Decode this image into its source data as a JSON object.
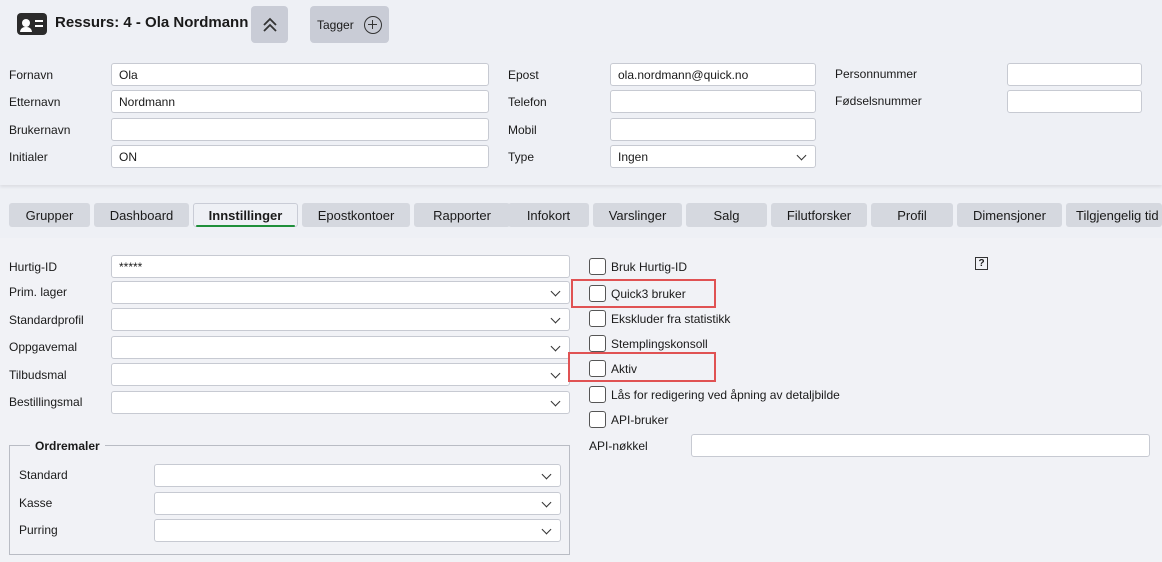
{
  "header": {
    "title": "Ressurs: 4 - Ola Nordmann",
    "tags_label": "Tagger"
  },
  "person": {
    "fornavn_label": "Fornavn",
    "fornavn": "Ola",
    "etternavn_label": "Etternavn",
    "etternavn": "Nordmann",
    "brukernavn_label": "Brukernavn",
    "brukernavn": "",
    "initialer_label": "Initialer",
    "initialer": "ON",
    "epost_label": "Epost",
    "epost": "ola.nordmann@quick.no",
    "telefon_label": "Telefon",
    "telefon": "",
    "mobil_label": "Mobil",
    "mobil": "",
    "type_label": "Type",
    "type": "Ingen",
    "personnummer_label": "Personnummer",
    "personnummer": "",
    "fodselsnummer_label": "Fødselsnummer",
    "fodselsnummer": ""
  },
  "tabs": [
    "Grupper",
    "Dashboard",
    "Innstillinger",
    "Epostkontoer",
    "Rapporter",
    "Infokort",
    "Varslinger",
    "Salg",
    "Filutforsker",
    "Profil",
    "Dimensjoner",
    "Tilgjengelig tid"
  ],
  "active_tab": "Innstillinger",
  "settings": {
    "hurtig_id_label": "Hurtig-ID",
    "hurtig_id": "*****",
    "prim_lager_label": "Prim. lager",
    "prim_lager": "",
    "standardprofil_label": "Standardprofil",
    "standardprofil": "",
    "oppgavemal_label": "Oppgavemal",
    "oppgavemal": "",
    "tilbudsmal_label": "Tilbudsmal",
    "tilbudsmal": "",
    "bestillingsmal_label": "Bestillingsmal",
    "bestillingsmal": "",
    "checkboxes": [
      {
        "label": "Bruk Hurtig-ID",
        "checked": false
      },
      {
        "label": "Quick3 bruker",
        "checked": false
      },
      {
        "label": "Ekskluder fra statistikk",
        "checked": false
      },
      {
        "label": "Stemplingskonsoll",
        "checked": false
      },
      {
        "label": "Aktiv",
        "checked": false
      },
      {
        "label": "Lås for redigering ved åpning av detaljbilde",
        "checked": false
      },
      {
        "label": "API-bruker",
        "checked": false
      }
    ],
    "api_key_label": "API-nøkkel",
    "api_key": "",
    "help_glyph": "?"
  },
  "ordremaler": {
    "legend": "Ordremaler",
    "standard_label": "Standard",
    "standard": "",
    "kasse_label": "Kasse",
    "kasse": "",
    "purring_label": "Purring",
    "purring": ""
  },
  "highlight_color": "#e05253",
  "active_tab_accent": "#1f8f3a"
}
